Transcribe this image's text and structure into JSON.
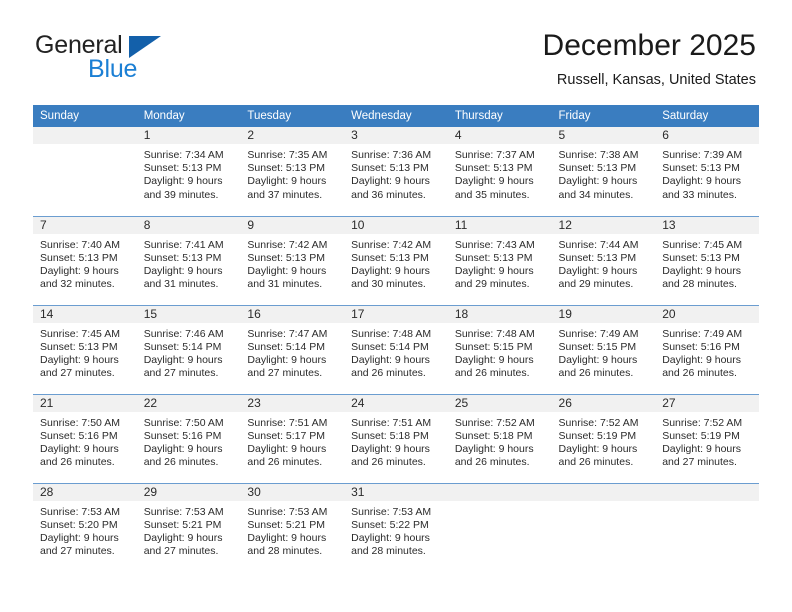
{
  "brand": {
    "name_part1": "General",
    "name_part2": "Blue",
    "accent_color": "#1b7fd4",
    "triangle_color": "#1360aa"
  },
  "header": {
    "title": "December 2025",
    "location": "Russell, Kansas, United States"
  },
  "theme": {
    "header_row_bg": "#3a7dc0",
    "daynum_band_bg": "#f1f1f1",
    "week_divider": "#6b9dd0",
    "text": "#2b2b2b"
  },
  "weekday_headers": [
    "Sunday",
    "Monday",
    "Tuesday",
    "Wednesday",
    "Thursday",
    "Friday",
    "Saturday"
  ],
  "weeks": [
    [
      {
        "day": "",
        "lines": []
      },
      {
        "day": "1",
        "lines": [
          "Sunrise: 7:34 AM",
          "Sunset: 5:13 PM",
          "Daylight: 9 hours",
          "and 39 minutes."
        ]
      },
      {
        "day": "2",
        "lines": [
          "Sunrise: 7:35 AM",
          "Sunset: 5:13 PM",
          "Daylight: 9 hours",
          "and 37 minutes."
        ]
      },
      {
        "day": "3",
        "lines": [
          "Sunrise: 7:36 AM",
          "Sunset: 5:13 PM",
          "Daylight: 9 hours",
          "and 36 minutes."
        ]
      },
      {
        "day": "4",
        "lines": [
          "Sunrise: 7:37 AM",
          "Sunset: 5:13 PM",
          "Daylight: 9 hours",
          "and 35 minutes."
        ]
      },
      {
        "day": "5",
        "lines": [
          "Sunrise: 7:38 AM",
          "Sunset: 5:13 PM",
          "Daylight: 9 hours",
          "and 34 minutes."
        ]
      },
      {
        "day": "6",
        "lines": [
          "Sunrise: 7:39 AM",
          "Sunset: 5:13 PM",
          "Daylight: 9 hours",
          "and 33 minutes."
        ]
      }
    ],
    [
      {
        "day": "7",
        "lines": [
          "Sunrise: 7:40 AM",
          "Sunset: 5:13 PM",
          "Daylight: 9 hours",
          "and 32 minutes."
        ]
      },
      {
        "day": "8",
        "lines": [
          "Sunrise: 7:41 AM",
          "Sunset: 5:13 PM",
          "Daylight: 9 hours",
          "and 31 minutes."
        ]
      },
      {
        "day": "9",
        "lines": [
          "Sunrise: 7:42 AM",
          "Sunset: 5:13 PM",
          "Daylight: 9 hours",
          "and 31 minutes."
        ]
      },
      {
        "day": "10",
        "lines": [
          "Sunrise: 7:42 AM",
          "Sunset: 5:13 PM",
          "Daylight: 9 hours",
          "and 30 minutes."
        ]
      },
      {
        "day": "11",
        "lines": [
          "Sunrise: 7:43 AM",
          "Sunset: 5:13 PM",
          "Daylight: 9 hours",
          "and 29 minutes."
        ]
      },
      {
        "day": "12",
        "lines": [
          "Sunrise: 7:44 AM",
          "Sunset: 5:13 PM",
          "Daylight: 9 hours",
          "and 29 minutes."
        ]
      },
      {
        "day": "13",
        "lines": [
          "Sunrise: 7:45 AM",
          "Sunset: 5:13 PM",
          "Daylight: 9 hours",
          "and 28 minutes."
        ]
      }
    ],
    [
      {
        "day": "14",
        "lines": [
          "Sunrise: 7:45 AM",
          "Sunset: 5:13 PM",
          "Daylight: 9 hours",
          "and 27 minutes."
        ]
      },
      {
        "day": "15",
        "lines": [
          "Sunrise: 7:46 AM",
          "Sunset: 5:14 PM",
          "Daylight: 9 hours",
          "and 27 minutes."
        ]
      },
      {
        "day": "16",
        "lines": [
          "Sunrise: 7:47 AM",
          "Sunset: 5:14 PM",
          "Daylight: 9 hours",
          "and 27 minutes."
        ]
      },
      {
        "day": "17",
        "lines": [
          "Sunrise: 7:48 AM",
          "Sunset: 5:14 PM",
          "Daylight: 9 hours",
          "and 26 minutes."
        ]
      },
      {
        "day": "18",
        "lines": [
          "Sunrise: 7:48 AM",
          "Sunset: 5:15 PM",
          "Daylight: 9 hours",
          "and 26 minutes."
        ]
      },
      {
        "day": "19",
        "lines": [
          "Sunrise: 7:49 AM",
          "Sunset: 5:15 PM",
          "Daylight: 9 hours",
          "and 26 minutes."
        ]
      },
      {
        "day": "20",
        "lines": [
          "Sunrise: 7:49 AM",
          "Sunset: 5:16 PM",
          "Daylight: 9 hours",
          "and 26 minutes."
        ]
      }
    ],
    [
      {
        "day": "21",
        "lines": [
          "Sunrise: 7:50 AM",
          "Sunset: 5:16 PM",
          "Daylight: 9 hours",
          "and 26 minutes."
        ]
      },
      {
        "day": "22",
        "lines": [
          "Sunrise: 7:50 AM",
          "Sunset: 5:16 PM",
          "Daylight: 9 hours",
          "and 26 minutes."
        ]
      },
      {
        "day": "23",
        "lines": [
          "Sunrise: 7:51 AM",
          "Sunset: 5:17 PM",
          "Daylight: 9 hours",
          "and 26 minutes."
        ]
      },
      {
        "day": "24",
        "lines": [
          "Sunrise: 7:51 AM",
          "Sunset: 5:18 PM",
          "Daylight: 9 hours",
          "and 26 minutes."
        ]
      },
      {
        "day": "25",
        "lines": [
          "Sunrise: 7:52 AM",
          "Sunset: 5:18 PM",
          "Daylight: 9 hours",
          "and 26 minutes."
        ]
      },
      {
        "day": "26",
        "lines": [
          "Sunrise: 7:52 AM",
          "Sunset: 5:19 PM",
          "Daylight: 9 hours",
          "and 26 minutes."
        ]
      },
      {
        "day": "27",
        "lines": [
          "Sunrise: 7:52 AM",
          "Sunset: 5:19 PM",
          "Daylight: 9 hours",
          "and 27 minutes."
        ]
      }
    ],
    [
      {
        "day": "28",
        "lines": [
          "Sunrise: 7:53 AM",
          "Sunset: 5:20 PM",
          "Daylight: 9 hours",
          "and 27 minutes."
        ]
      },
      {
        "day": "29",
        "lines": [
          "Sunrise: 7:53 AM",
          "Sunset: 5:21 PM",
          "Daylight: 9 hours",
          "and 27 minutes."
        ]
      },
      {
        "day": "30",
        "lines": [
          "Sunrise: 7:53 AM",
          "Sunset: 5:21 PM",
          "Daylight: 9 hours",
          "and 28 minutes."
        ]
      },
      {
        "day": "31",
        "lines": [
          "Sunrise: 7:53 AM",
          "Sunset: 5:22 PM",
          "Daylight: 9 hours",
          "and 28 minutes."
        ]
      },
      {
        "day": "",
        "lines": []
      },
      {
        "day": "",
        "lines": []
      },
      {
        "day": "",
        "lines": []
      }
    ]
  ]
}
